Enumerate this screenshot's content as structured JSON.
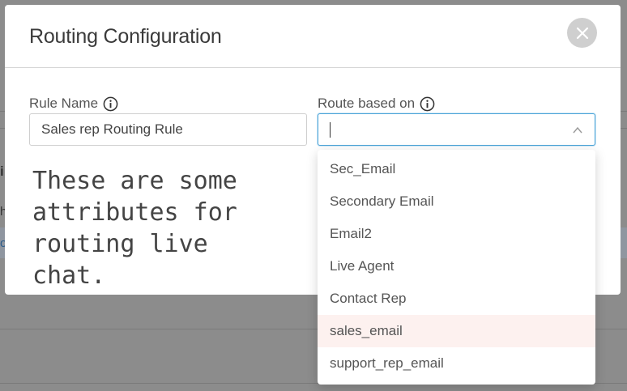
{
  "modal": {
    "title": "Routing Configuration"
  },
  "rule_name": {
    "label": "Rule Name",
    "value": "Sales rep Routing Rule"
  },
  "route_based_on": {
    "label": "Route based on",
    "value": "",
    "options": [
      "Sec_Email",
      "Secondary Email",
      "Email2",
      "Live Agent",
      "Contact Rep",
      "sales_email",
      "support_rep_email"
    ],
    "highlighted_index": 5
  },
  "note": "These are some attributes for routing live chat.",
  "background": {
    "fragment_1": "i",
    "fragment_2": "h",
    "fragment_3": "o"
  },
  "colors": {
    "focus_border": "#4aa3d8",
    "highlight_bg": "#fdf1ef",
    "overlay": "#8c8c8c"
  }
}
